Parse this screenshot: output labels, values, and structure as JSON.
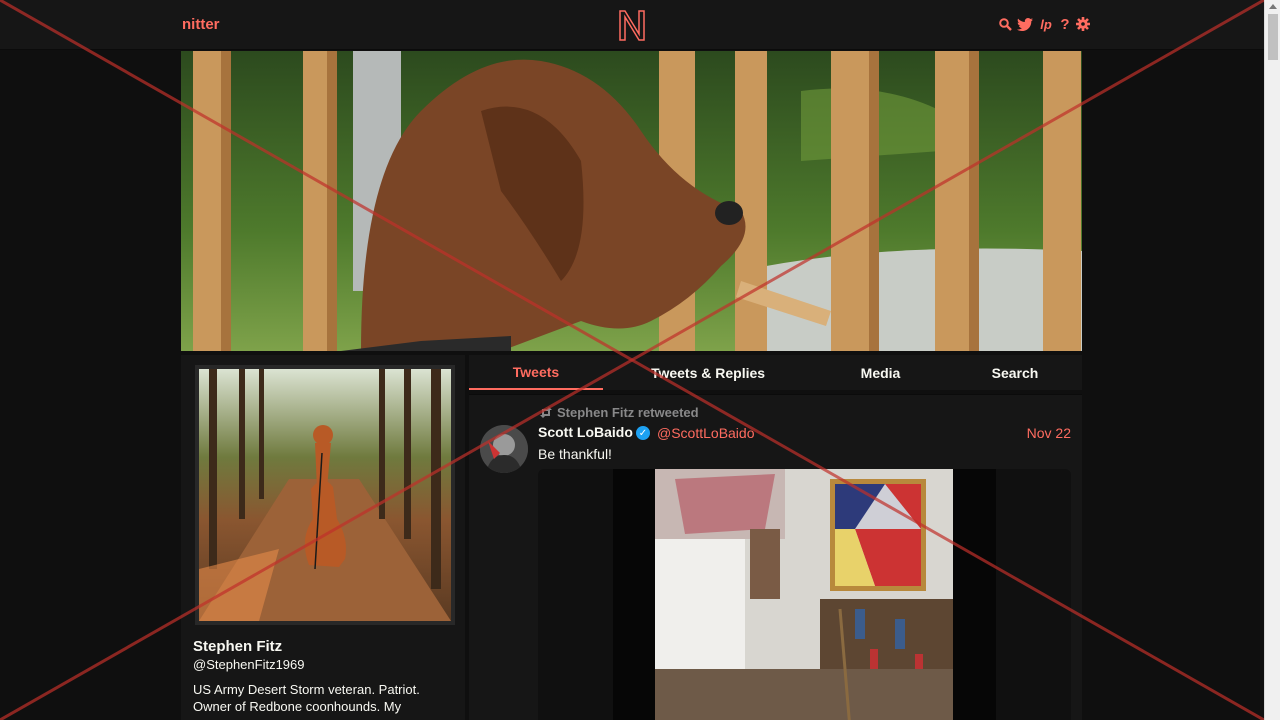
{
  "navbar": {
    "brand": "nitter",
    "logo_letter": "N",
    "icons": [
      "search-icon",
      "twitter-bird-icon",
      "liberapay-icon",
      "help-icon",
      "settings-gear-icon"
    ]
  },
  "profile": {
    "fullname": "Stephen Fitz",
    "username": "@StephenFitz1969",
    "bio": "US Army Desert Storm veteran. Patriot. Owner of Redbone coonhounds. My"
  },
  "tabs": [
    {
      "label": "Tweets",
      "active": true
    },
    {
      "label": "Tweets & Replies",
      "active": false
    },
    {
      "label": "Media",
      "active": false
    },
    {
      "label": "Search",
      "active": false
    }
  ],
  "tweet": {
    "retweet_header": "Stephen Fitz retweeted",
    "fullname": "Scott LoBaido",
    "verified": true,
    "username": "@ScottLoBaido",
    "date": "Nov 22",
    "text": "Be thankful!"
  },
  "colors": {
    "accent": "#ff6c60",
    "background": "#0f0f0f",
    "panel": "#161616",
    "text": "#f8f8f2",
    "muted": "#888889",
    "verified": "#1da1f2"
  }
}
